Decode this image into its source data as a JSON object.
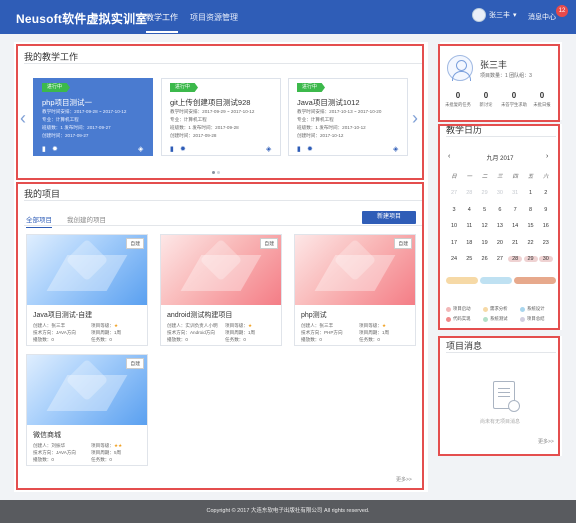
{
  "header": {
    "logo": "Neusoft软件虚拟实训室",
    "nav": [
      "教学工作",
      "项目资源管理"
    ],
    "user_name": "张三丰",
    "user_caret": "▾",
    "messages_label": "消息中心",
    "messages_count": "12",
    "bg_color": "#2f5db7"
  },
  "teaching": {
    "title": "我的教学工作",
    "cards": [
      {
        "tag": "进行中",
        "title": "php项目测试一",
        "lines": [
          "教学时间安排：2017-09-28 ~ 2017-10-12",
          "专业：计算机工程",
          "班级数：1    发布时间：2017-09-27",
          "创建时间：2017-09-27"
        ]
      },
      {
        "tag": "进行中",
        "title": "git上传创建项目测试928",
        "lines": [
          "教学时间安排：2017-09-29 ~ 2017-10-12",
          "专业：计算机工程",
          "班级数：1    发布时间：2017-09-28",
          "创建时间：2017-09-28"
        ]
      },
      {
        "tag": "进行中",
        "title": "Java项目测试1012",
        "lines": [
          "教学时间安排：2017-10-13 ~ 2017-10-20",
          "专业：计算机工程",
          "班级数：1    发布时间：2017-10-12",
          "创建时间：2017-10-12"
        ]
      }
    ],
    "prev_icon": "‹",
    "next_icon": "›"
  },
  "projects": {
    "title": "我的项目",
    "tabs": [
      "全部项目",
      "我创建的项目"
    ],
    "new_button": "新建项目",
    "cards": [
      {
        "badge": "自建",
        "title": "Java项目测试-自建",
        "creator": "创建人：张三丰",
        "level": "项目等级：",
        "stars": "★",
        "direction": "技术方向：JAVA方向",
        "period": "项目周期：1周",
        "plays": "播放数：0",
        "tasks": "任务数：0"
      },
      {
        "badge": "自建",
        "title": "android测试构建项目",
        "creator": "创建人：实训负责人小明",
        "level": "项目等级：",
        "stars": "★",
        "direction": "技术方向：Android方向",
        "period": "项目周期：1周",
        "plays": "播放数：0",
        "tasks": "任务数：0"
      },
      {
        "badge": "自建",
        "title": "php测试",
        "creator": "创建人：张三丰",
        "level": "项目等级：",
        "stars": "★",
        "direction": "技术方向：PHP方向",
        "period": "项目周期：1周",
        "plays": "播放数：0",
        "tasks": "任务数：0"
      },
      {
        "badge": "自建",
        "title": "微信商城",
        "creator": "创建人：刘振华",
        "level": "项目等级：",
        "stars": "★★",
        "direction": "技术方向：JAVA方向",
        "period": "项目周期：5周",
        "plays": "播放数：0",
        "tasks": "任务数：0"
      }
    ],
    "more": "更多>>"
  },
  "profile": {
    "name": "张三丰",
    "meta": "项目数量：1   团队组：3",
    "stats": [
      {
        "n": "0",
        "label": "未批复的任务"
      },
      {
        "n": "0",
        "label": "新讨论"
      },
      {
        "n": "0",
        "label": "未答学生求助"
      },
      {
        "n": "0",
        "label": "未批日报"
      }
    ]
  },
  "calendar": {
    "title": "教学日历",
    "month": "九月 2017",
    "prev": "‹",
    "next": "›",
    "weekdays": [
      "日",
      "一",
      "二",
      "三",
      "四",
      "五",
      "六"
    ],
    "weeks": [
      [
        "27",
        "28",
        "29",
        "30",
        "31",
        "1",
        "2"
      ],
      [
        "3",
        "4",
        "5",
        "6",
        "7",
        "8",
        "9"
      ],
      [
        "10",
        "11",
        "12",
        "13",
        "14",
        "15",
        "16"
      ],
      [
        "17",
        "18",
        "19",
        "20",
        "21",
        "22",
        "23"
      ],
      [
        "24",
        "25",
        "26",
        "27",
        "28",
        "29",
        "30"
      ]
    ],
    "legend": [
      {
        "label": "项目启动",
        "color": "#f2b8b8"
      },
      {
        "label": "需求分析",
        "color": "#f6d9a6"
      },
      {
        "label": "系统设计",
        "color": "#a9d6ee"
      },
      {
        "label": "代码实现",
        "color": "#f08a8a"
      },
      {
        "label": "系统测试",
        "color": "#b3e0c8"
      },
      {
        "label": "项目总结",
        "color": "#d2cfe0"
      }
    ]
  },
  "messages": {
    "title": "项目消息",
    "empty": "尚未有无项目消息",
    "more": "更多>>"
  },
  "footer": {
    "text": "Copyright © 2017 大连东软电子出版社有限公司 All rights reserved."
  }
}
